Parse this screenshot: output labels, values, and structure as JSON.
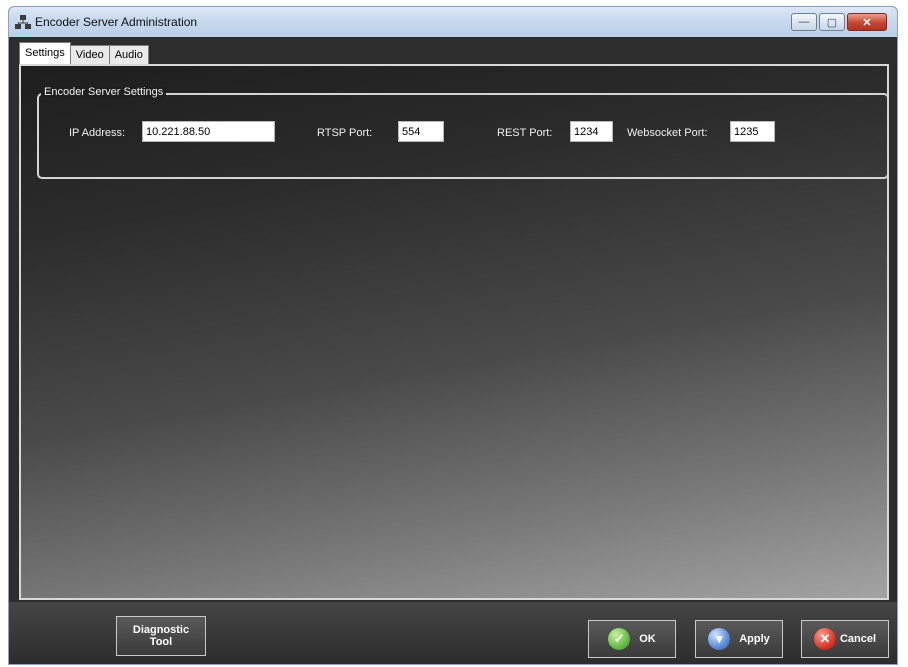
{
  "window": {
    "title": "Encoder Server Administration",
    "controls": {
      "minimize": "—",
      "maximize": "▢",
      "close": "✕"
    }
  },
  "tabs": [
    {
      "label": "Settings",
      "active": true
    },
    {
      "label": "Video",
      "active": false
    },
    {
      "label": "Audio",
      "active": false
    }
  ],
  "settings": {
    "group_title": "Encoder Server Settings",
    "ip_label": "IP Address:",
    "ip_value": "10.221.88.50",
    "rtsp_label": "RTSP Port:",
    "rtsp_value": "554",
    "rest_label": "REST Port:",
    "rest_value": "1234",
    "websocket_label": "Websocket Port:",
    "websocket_value": "1235"
  },
  "footer": {
    "diagnostic_line1": "Diagnostic",
    "diagnostic_line2": "Tool",
    "ok_label": "OK",
    "apply_label": "Apply",
    "cancel_label": "Cancel"
  },
  "icons": {
    "app": "network-icon",
    "ok": "checkmark-icon",
    "apply": "apply-icon",
    "cancel": "close-x-icon"
  },
  "colors": {
    "ok_green": "#55b33a",
    "apply_blue": "#4a7fd4",
    "cancel_red": "#d22a1a",
    "close_button_red": "#c8452e"
  }
}
